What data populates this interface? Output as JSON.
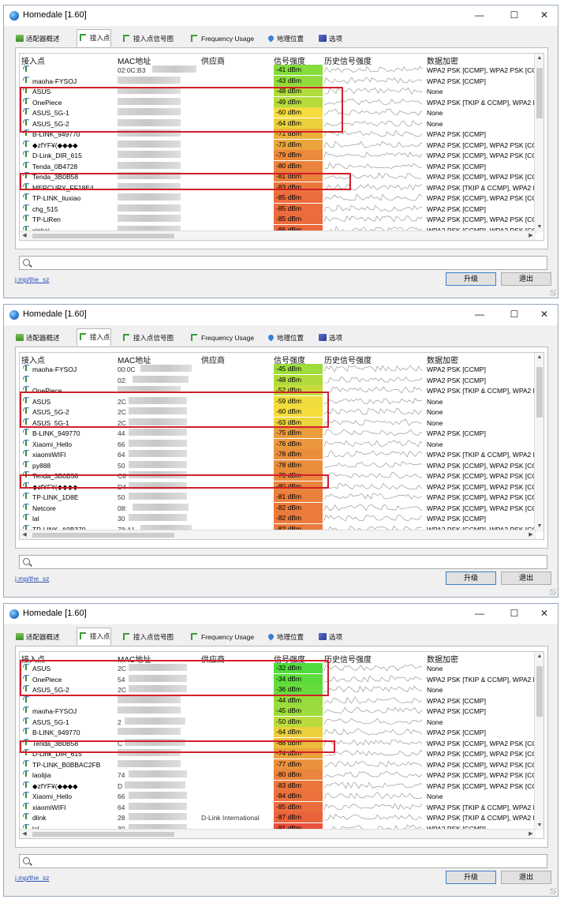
{
  "app": {
    "title": "Homedale [1.60]",
    "controls": {
      "minimize": "—",
      "maximize": "☐",
      "close": "✕"
    },
    "tabs": [
      "适配器概述",
      "接入点",
      "接入点信号图",
      "Frequency Usage",
      "地理位置",
      "选项"
    ],
    "active_tab": 1,
    "columns": [
      "接入点",
      "MAC地址",
      "供应商",
      "信号强度",
      "历史信号强度",
      "数据加密"
    ],
    "search_icon": "magnifier-icon",
    "link_text": "j.mp/the_sz",
    "upgrade_label": "升级",
    "exit_label": "退出"
  },
  "colors": {
    "highlight": "#d21f2a",
    "signal_strong": "#4ad64a",
    "signal_mid": "#e8e83a",
    "signal_weak": "#e85a3a"
  },
  "windows": [
    {
      "rows": [
        {
          "name": "",
          "mac": "02:0C:B3",
          "vendor": "",
          "signal": "-41 dBm",
          "enc": "WPA2 PSK [CCMP], WPA2 PSK [CCI"
        },
        {
          "name": "maoha-FYSOJ",
          "mac": "",
          "vendor": "",
          "signal": "-43 dBm",
          "enc": "WPA2 PSK [CCMP]"
        },
        {
          "name": "ASUS",
          "mac": "",
          "vendor": "",
          "signal": "-48 dBm",
          "enc": "None"
        },
        {
          "name": "OnePiece",
          "mac": "",
          "vendor": "",
          "signal": "-49 dBm",
          "enc": "WPA2 PSK [TKIP & CCMP], WPA2 P"
        },
        {
          "name": "ASUS_5G-1",
          "mac": "",
          "vendor": "",
          "signal": "-60 dBm",
          "enc": "None"
        },
        {
          "name": "ASUS_5G-2",
          "mac": "",
          "vendor": "",
          "signal": "-64 dBm",
          "enc": "None"
        },
        {
          "name": "B-LINK_949770",
          "mac": "",
          "vendor": "",
          "signal": "-71 dBm",
          "enc": "WPA2 PSK [CCMP]"
        },
        {
          "name": "◆zfYF¥(◆◆◆◆",
          "mac": "",
          "vendor": "",
          "signal": "-73 dBm",
          "enc": "WPA2 PSK [CCMP], WPA2 PSK [CCI"
        },
        {
          "name": "D-Link_DIR_615",
          "mac": "",
          "vendor": "",
          "signal": "-79 dBm",
          "enc": "WPA2 PSK [CCMP], WPA2 PSK [CCI"
        },
        {
          "name": "Tenda_0B4728",
          "mac": "",
          "vendor": "",
          "signal": "-80 dBm",
          "enc": "WPA2 PSK [CCMP]"
        },
        {
          "name": "Tenda_3B0B58",
          "mac": "",
          "vendor": "",
          "signal": "-81 dBm",
          "enc": "WPA2 PSK [CCMP], WPA2 PSK [CCI"
        },
        {
          "name": "MERCURY_FF18E4",
          "mac": "",
          "vendor": "",
          "signal": "-83 dBm",
          "enc": "WPA2 PSK [TKIP & CCMP], WPA2 P"
        },
        {
          "name": "TP-LINK_liuxiao",
          "mac": "",
          "vendor": "",
          "signal": "-85 dBm",
          "enc": "WPA2 PSK [CCMP], WPA2 PSK [CCI"
        },
        {
          "name": "chg_515",
          "mac": "",
          "vendor": "",
          "signal": "-85 dBm",
          "enc": "WPA2 PSK [CCMP]"
        },
        {
          "name": "TP-LiRen",
          "mac": "",
          "vendor": "",
          "signal": "-85 dBm",
          "enc": "WPA2 PSK [CCMP], WPA2 PSK [CCI"
        },
        {
          "name": "xiekai",
          "mac": "",
          "vendor": "",
          "signal": "-86 dBm",
          "enc": "WPA2 PSK [CCMP], WPA2 PSK [CCI"
        }
      ]
    },
    {
      "rows": [
        {
          "name": "maoha-FYSOJ",
          "mac": "00:0C",
          "vendor": "",
          "signal": "-45 dBm",
          "enc": "WPA2 PSK [CCMP]"
        },
        {
          "name": "",
          "mac": "02:",
          "vendor": "",
          "signal": "-48 dBm",
          "enc": "WPA2 PSK [CCMP]"
        },
        {
          "name": "OnePiece",
          "mac": "",
          "vendor": "",
          "signal": "-52 dBm",
          "enc": "WPA2 PSK [TKIP & CCMP], WPA2 P"
        },
        {
          "name": "ASUS",
          "mac": "2C",
          "vendor": "",
          "signal": "-59 dBm",
          "enc": "None"
        },
        {
          "name": "ASUS_5G-2",
          "mac": "2C",
          "vendor": "",
          "signal": "-60 dBm",
          "enc": "None"
        },
        {
          "name": "ASUS_5G-1",
          "mac": "2C",
          "vendor": "",
          "signal": "-63 dBm",
          "enc": "None"
        },
        {
          "name": "B-LINK_949770",
          "mac": "44",
          "vendor": "",
          "signal": "-75 dBm",
          "enc": "WPA2 PSK [CCMP]"
        },
        {
          "name": "Xiaomi_Hello",
          "mac": "66",
          "vendor": "",
          "signal": "-76 dBm",
          "enc": "None"
        },
        {
          "name": "xiaomiWIFI",
          "mac": "64",
          "vendor": "",
          "signal": "-78 dBm",
          "enc": "WPA2 PSK [TKIP & CCMP], WPA2 P"
        },
        {
          "name": "py888",
          "mac": "50",
          "vendor": "",
          "signal": "-78 dBm",
          "enc": "WPA2 PSK [CCMP], WPA2 PSK [CCI"
        },
        {
          "name": "Tenda_3B0B58",
          "mac": "C8",
          "vendor": "",
          "signal": "-79 dBm",
          "enc": "WPA2 PSK [CCMP], WPA2 PSK [CCI"
        },
        {
          "name": "◆zfYF¥(◆◆◆◆",
          "mac": "D4",
          "vendor": "",
          "signal": "-80 dBm",
          "enc": "WPA2 PSK [CCMP], WPA2 PSK [CCI"
        },
        {
          "name": "TP-LINK_1D8E",
          "mac": "50",
          "vendor": "",
          "signal": "-81 dBm",
          "enc": "WPA2 PSK [CCMP], WPA2 PSK [CCI"
        },
        {
          "name": "Netcore",
          "mac": "08:",
          "vendor": "",
          "signal": "-82 dBm",
          "enc": "WPA2 PSK [CCMP], WPA2 PSK [CCI"
        },
        {
          "name": "lal",
          "mac": "30",
          "vendor": "",
          "signal": "-82 dBm",
          "enc": "WPA2 PSK [CCMP]"
        },
        {
          "name": "TP-LINK_A9B370",
          "mac": "78:A1",
          "vendor": "",
          "signal": "-82 dBm",
          "enc": "WPA2 PSK [CCMP], WPA2 PSK [CCI"
        }
      ]
    },
    {
      "rows": [
        {
          "name": "ASUS",
          "mac": "2C",
          "vendor": "",
          "signal": "-32 dBm",
          "enc": "None"
        },
        {
          "name": "OnePiece",
          "mac": "54",
          "vendor": "",
          "signal": "-34 dBm",
          "enc": "WPA2 PSK [TKIP & CCMP], WPA2 P"
        },
        {
          "name": "ASUS_5G-2",
          "mac": "2C",
          "vendor": "",
          "signal": "-36 dBm",
          "enc": "None"
        },
        {
          "name": "",
          "mac": "",
          "vendor": "",
          "signal": "-44 dBm",
          "enc": "WPA2 PSK [CCMP]"
        },
        {
          "name": "maoha-FYSOJ",
          "mac": "",
          "vendor": "",
          "signal": "-45 dBm",
          "enc": "WPA2 PSK [CCMP]"
        },
        {
          "name": "ASUS_5G-1",
          "mac": "2",
          "vendor": "",
          "signal": "-50 dBm",
          "enc": "None"
        },
        {
          "name": "B-LINK_949770",
          "mac": "",
          "vendor": "",
          "signal": "-64 dBm",
          "enc": "WPA2 PSK [CCMP]"
        },
        {
          "name": "Tenda_3B0B58",
          "mac": "C",
          "vendor": "",
          "signal": "-68 dBm",
          "enc": "WPA2 PSK [CCMP], WPA2 PSK [CCI"
        },
        {
          "name": "D-Link_DIR_615",
          "mac": "",
          "vendor": "",
          "signal": "-74 dBm",
          "enc": "WPA2 PSK [CCMP], WPA2 PSK [CCI"
        },
        {
          "name": "TP-LINK_B0BBAC2FB",
          "mac": "",
          "vendor": "",
          "signal": "-77 dBm",
          "enc": "WPA2 PSK [CCMP], WPA2 PSK [CCI"
        },
        {
          "name": "laolijia",
          "mac": "74",
          "vendor": "",
          "signal": "-80 dBm",
          "enc": "WPA2 PSK [CCMP], WPA2 PSK [CCI"
        },
        {
          "name": "◆zfYF¥(◆◆◆◆",
          "mac": "D",
          "vendor": "",
          "signal": "-83 dBm",
          "enc": "WPA2 PSK [CCMP], WPA2 PSK [CCI"
        },
        {
          "name": "Xiaomi_Hello",
          "mac": "66",
          "vendor": "",
          "signal": "-84 dBm",
          "enc": "None"
        },
        {
          "name": "xiaomiWIFI",
          "mac": "64",
          "vendor": "",
          "signal": "-85 dBm",
          "enc": "WPA2 PSK [TKIP & CCMP], WPA2 P"
        },
        {
          "name": "dlink",
          "mac": "28",
          "vendor": "D-Link International",
          "signal": "-87 dBm",
          "enc": "WPA2 PSK [TKIP & CCMP], WPA2 P"
        },
        {
          "name": "lal",
          "mac": "30",
          "vendor": "",
          "signal": "-91 dBm",
          "enc": "WPA2 PSK [CCMP]"
        }
      ]
    }
  ]
}
